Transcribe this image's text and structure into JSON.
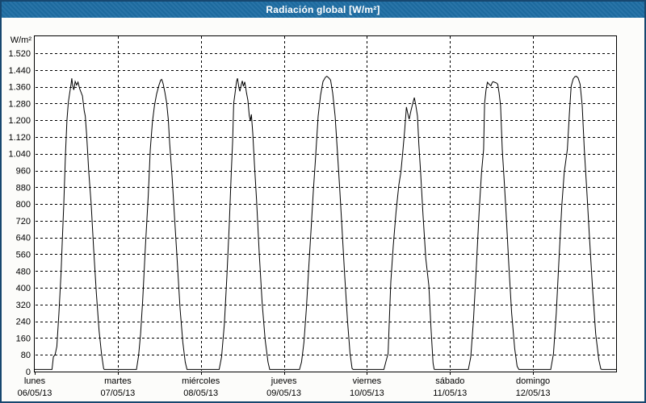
{
  "window": {
    "title": "Radiación global [W/m²]"
  },
  "colors": {
    "title_bar": "#1e6da3",
    "title_text": "#ffffff",
    "frame": "#17476f",
    "background": "#fcfcfa",
    "plot_background": "#ffffff",
    "plot_border": "#000000",
    "grid": "#000000",
    "line": "#000000",
    "label_text": "#000000"
  },
  "chart_data": {
    "type": "line",
    "title": "Radiación global [W/m²]",
    "unit_label": "W/m²",
    "ylabel": "W/m²",
    "xlabel": "",
    "ylim": [
      0,
      1604
    ],
    "y_tick_step": 80,
    "grid": "dashed",
    "legend": "none",
    "y_ticks": [
      {
        "value": 1520,
        "label": "1.520"
      },
      {
        "value": 1440,
        "label": "1.440"
      },
      {
        "value": 1360,
        "label": "1.360"
      },
      {
        "value": 1280,
        "label": "1.280"
      },
      {
        "value": 1200,
        "label": "1.200"
      },
      {
        "value": 1120,
        "label": "1.120"
      },
      {
        "value": 1040,
        "label": "1.040"
      },
      {
        "value": 960,
        "label": "960"
      },
      {
        "value": 880,
        "label": "880"
      },
      {
        "value": 800,
        "label": "800"
      },
      {
        "value": 720,
        "label": "720"
      },
      {
        "value": 640,
        "label": "640"
      },
      {
        "value": 560,
        "label": "560"
      },
      {
        "value": 480,
        "label": "480"
      },
      {
        "value": 400,
        "label": "400"
      },
      {
        "value": 320,
        "label": "320"
      },
      {
        "value": 240,
        "label": "240"
      },
      {
        "value": 160,
        "label": "160"
      },
      {
        "value": 80,
        "label": "80"
      },
      {
        "value": 0,
        "label": "0"
      }
    ],
    "days": [
      {
        "name": "lunes",
        "date": "06/05/13",
        "peak_wm2": 1400,
        "points_hour_wm2": [
          [
            0,
            10
          ],
          [
            5.0,
            10
          ],
          [
            5.4,
            70
          ],
          [
            5.9,
            82
          ],
          [
            6.4,
            120
          ],
          [
            7.0,
            280
          ],
          [
            7.6,
            470
          ],
          [
            8.0,
            640
          ],
          [
            8.4,
            800
          ],
          [
            8.9,
            1040
          ],
          [
            9.3,
            1200
          ],
          [
            9.7,
            1285
          ],
          [
            10.1,
            1330
          ],
          [
            10.5,
            1372
          ],
          [
            10.7,
            1400
          ],
          [
            11.0,
            1362
          ],
          [
            11.3,
            1345
          ],
          [
            11.7,
            1385
          ],
          [
            12.1,
            1368
          ],
          [
            12.5,
            1382
          ],
          [
            13.0,
            1350
          ],
          [
            13.8,
            1316
          ],
          [
            14.3,
            1245
          ],
          [
            14.6,
            1220
          ],
          [
            15.0,
            1130
          ],
          [
            15.6,
            955
          ],
          [
            16.3,
            800
          ],
          [
            17.0,
            590
          ],
          [
            17.8,
            375
          ],
          [
            18.6,
            195
          ],
          [
            19.3,
            85
          ],
          [
            19.9,
            15
          ],
          [
            20.1,
            10
          ],
          [
            24,
            10
          ]
        ]
      },
      {
        "name": "martes",
        "date": "07/05/13",
        "peak_wm2": 1395,
        "points_hour_wm2": [
          [
            0,
            10
          ],
          [
            5.4,
            10
          ],
          [
            6.0,
            75
          ],
          [
            6.6,
            180
          ],
          [
            7.2,
            340
          ],
          [
            8.0,
            600
          ],
          [
            8.8,
            840
          ],
          [
            9.4,
            1060
          ],
          [
            10.0,
            1190
          ],
          [
            10.6,
            1270
          ],
          [
            11.2,
            1325
          ],
          [
            11.9,
            1368
          ],
          [
            12.4,
            1392
          ],
          [
            12.7,
            1395
          ],
          [
            13.1,
            1375
          ],
          [
            13.6,
            1335
          ],
          [
            14.1,
            1285
          ],
          [
            14.6,
            1205
          ],
          [
            15.0,
            1090
          ],
          [
            15.7,
            930
          ],
          [
            16.4,
            740
          ],
          [
            17.2,
            520
          ],
          [
            18.0,
            300
          ],
          [
            18.8,
            140
          ],
          [
            19.5,
            45
          ],
          [
            20.0,
            10
          ],
          [
            24,
            10
          ]
        ]
      },
      {
        "name": "miércoles",
        "date": "08/05/13",
        "peak_wm2": 1400,
        "points_hour_wm2": [
          [
            0,
            10
          ],
          [
            5.3,
            10
          ],
          [
            6.0,
            70
          ],
          [
            6.8,
            230
          ],
          [
            7.5,
            450
          ],
          [
            8.2,
            700
          ],
          [
            8.8,
            950
          ],
          [
            9.2,
            1100
          ],
          [
            9.5,
            1280
          ],
          [
            9.9,
            1330
          ],
          [
            10.3,
            1385
          ],
          [
            10.6,
            1400
          ],
          [
            11.0,
            1355
          ],
          [
            11.3,
            1338
          ],
          [
            11.7,
            1372
          ],
          [
            12.0,
            1388
          ],
          [
            12.3,
            1362
          ],
          [
            12.7,
            1383
          ],
          [
            13.2,
            1330
          ],
          [
            13.6,
            1295
          ],
          [
            14.0,
            1222
          ],
          [
            14.3,
            1196
          ],
          [
            14.6,
            1228
          ],
          [
            15.0,
            1140
          ],
          [
            15.5,
            990
          ],
          [
            16.1,
            820
          ],
          [
            16.9,
            560
          ],
          [
            17.7,
            330
          ],
          [
            18.6,
            150
          ],
          [
            19.4,
            45
          ],
          [
            19.9,
            10
          ],
          [
            24,
            10
          ]
        ]
      },
      {
        "name": "jueves",
        "date": "09/05/13",
        "peak_wm2": 1410,
        "points_hour_wm2": [
          [
            0,
            10
          ],
          [
            4.5,
            10
          ],
          [
            5.1,
            45
          ],
          [
            5.8,
            140
          ],
          [
            6.5,
            300
          ],
          [
            7.2,
            500
          ],
          [
            7.9,
            690
          ],
          [
            8.5,
            860
          ],
          [
            9.1,
            1010
          ],
          [
            9.9,
            1220
          ],
          [
            10.6,
            1320
          ],
          [
            11.3,
            1385
          ],
          [
            12.0,
            1405
          ],
          [
            12.4,
            1410
          ],
          [
            12.9,
            1403
          ],
          [
            13.5,
            1392
          ],
          [
            14.1,
            1330
          ],
          [
            14.8,
            1220
          ],
          [
            15.5,
            1040
          ],
          [
            16.1,
            880
          ],
          [
            16.8,
            680
          ],
          [
            17.6,
            450
          ],
          [
            18.4,
            240
          ],
          [
            19.1,
            90
          ],
          [
            19.7,
            15
          ],
          [
            20.0,
            10
          ],
          [
            24,
            10
          ]
        ]
      },
      {
        "name": "viernes",
        "date": "10/05/13",
        "peak_wm2": 1308,
        "points_hour_wm2": [
          [
            0,
            10
          ],
          [
            4.9,
            10
          ],
          [
            5.6,
            55
          ],
          [
            6.1,
            85
          ],
          [
            6.5,
            260
          ],
          [
            6.9,
            430
          ],
          [
            7.6,
            600
          ],
          [
            8.4,
            760
          ],
          [
            9.2,
            890
          ],
          [
            9.8,
            950
          ],
          [
            10.3,
            1040
          ],
          [
            10.9,
            1150
          ],
          [
            11.4,
            1263
          ],
          [
            11.8,
            1232
          ],
          [
            12.2,
            1205
          ],
          [
            12.7,
            1245
          ],
          [
            13.2,
            1278
          ],
          [
            13.7,
            1308
          ],
          [
            14.1,
            1272
          ],
          [
            14.6,
            1220
          ],
          [
            15.0,
            1085
          ],
          [
            15.5,
            950
          ],
          [
            16.2,
            745
          ],
          [
            17.0,
            540
          ],
          [
            17.9,
            410
          ],
          [
            18.5,
            210
          ],
          [
            19.1,
            40
          ],
          [
            19.4,
            12
          ],
          [
            19.6,
            10
          ],
          [
            24,
            10
          ]
        ]
      },
      {
        "name": "sábado",
        "date": "11/05/13",
        "peak_wm2": 1384,
        "points_hour_wm2": [
          [
            0,
            10
          ],
          [
            5.3,
            10
          ],
          [
            6.0,
            70
          ],
          [
            6.8,
            250
          ],
          [
            7.6,
            500
          ],
          [
            8.4,
            760
          ],
          [
            9.1,
            950
          ],
          [
            9.7,
            1060
          ],
          [
            10.0,
            1280
          ],
          [
            10.4,
            1345
          ],
          [
            10.8,
            1381
          ],
          [
            11.3,
            1372
          ],
          [
            11.8,
            1364
          ],
          [
            12.1,
            1376
          ],
          [
            12.4,
            1384
          ],
          [
            12.9,
            1381
          ],
          [
            13.4,
            1378
          ],
          [
            13.8,
            1372
          ],
          [
            14.2,
            1330
          ],
          [
            14.6,
            1270
          ],
          [
            15.1,
            1060
          ],
          [
            15.6,
            930
          ],
          [
            16.2,
            760
          ],
          [
            17.0,
            510
          ],
          [
            17.8,
            280
          ],
          [
            18.7,
            110
          ],
          [
            19.4,
            25
          ],
          [
            19.9,
            10
          ],
          [
            24,
            10
          ]
        ]
      },
      {
        "name": "domingo",
        "date": "12/05/13",
        "peak_wm2": 1410,
        "points_hour_wm2": [
          [
            0,
            10
          ],
          [
            5.1,
            10
          ],
          [
            5.9,
            85
          ],
          [
            6.7,
            280
          ],
          [
            7.5,
            540
          ],
          [
            8.3,
            790
          ],
          [
            9.0,
            950
          ],
          [
            9.9,
            1060
          ],
          [
            10.5,
            1230
          ],
          [
            11.0,
            1362
          ],
          [
            11.6,
            1398
          ],
          [
            12.1,
            1408
          ],
          [
            12.5,
            1410
          ],
          [
            13.0,
            1402
          ],
          [
            13.6,
            1372
          ],
          [
            14.2,
            1270
          ],
          [
            14.8,
            1060
          ],
          [
            15.5,
            870
          ],
          [
            16.3,
            640
          ],
          [
            17.2,
            390
          ],
          [
            18.1,
            180
          ],
          [
            19.0,
            55
          ],
          [
            19.6,
            12
          ],
          [
            19.9,
            10
          ],
          [
            24,
            10
          ]
        ]
      }
    ]
  }
}
